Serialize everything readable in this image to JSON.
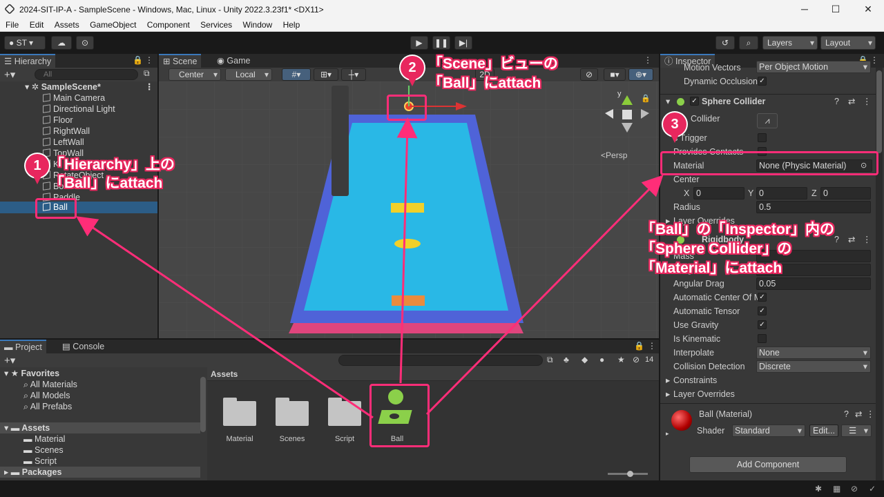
{
  "window": {
    "title": "2024-SIT-IP-A - SampleScene - Windows, Mac, Linux - Unity 2022.3.23f1* <DX11>",
    "minimize": "─",
    "maximize": "☐",
    "close": "✕"
  },
  "menu": [
    "File",
    "Edit",
    "Assets",
    "GameObject",
    "Component",
    "Services",
    "Window",
    "Help"
  ],
  "toolbar": {
    "account": "ST",
    "layers": "Layers",
    "layout": "Layout"
  },
  "hierarchy": {
    "tab": "Hierarchy",
    "search_placeholder": "All",
    "scene": "SampleScene*",
    "items": [
      "Main Camera",
      "Directional Light",
      "Floor",
      "RightWall",
      "LeftWall",
      "TopWall",
      "K",
      "RotateObject",
      "Bou",
      "Paddle",
      "Ball"
    ]
  },
  "scene_view": {
    "tab_scene": "Scene",
    "tab_game": "Game",
    "pivot": "Center",
    "space": "Local",
    "persp": "Persp",
    "mode2d": "2D",
    "gizmo_y": "y"
  },
  "inspector": {
    "tab": "Inspector",
    "top_rows": [
      {
        "label": "Motion Vectors",
        "value": "Per Object Motion"
      },
      {
        "label": "Dynamic Occlusion",
        "checked": "✓"
      }
    ],
    "sphere_collider": {
      "title": "Sphere Collider",
      "edit_collider": "Collider",
      "is_trigger": "s Trigger",
      "provides_contacts": "Provides Contacts",
      "material_label": "Material",
      "material_value": "None (Physic Material)",
      "center_label": "Center",
      "x": "0",
      "y": "0",
      "z": "0",
      "x_label": "X",
      "y_label": "Y",
      "z_label": "Z",
      "radius_label": "Radius",
      "radius_value": "0.5",
      "layer_overrides": "Layer Overrides"
    },
    "rigidbody": {
      "title": "Rigidbody",
      "mass": "Mass",
      "drag": "Drag",
      "angular_drag_label": "Angular Drag",
      "angular_drag": "0.05",
      "rows": [
        {
          "label": "Automatic Center Of M",
          "checked": "✓"
        },
        {
          "label": "Automatic Tensor",
          "checked": "✓"
        },
        {
          "label": "Use Gravity",
          "checked": "✓"
        },
        {
          "label": "Is Kinematic",
          "checked": ""
        }
      ],
      "interpolate_label": "Interpolate",
      "interpolate": "None",
      "collision_label": "Collision Detection",
      "collision": "Discrete",
      "constraints": "Constraints",
      "layer_overrides": "Layer Overrides"
    },
    "material": {
      "name": "Ball (Material)",
      "shader_label": "Shader",
      "shader": "Standard",
      "edit": "Edit..."
    },
    "add_component": "Add Component"
  },
  "project": {
    "tab_project": "Project",
    "tab_console": "Console",
    "hidden_count": "14",
    "favorites": "Favorites",
    "fav_items": [
      "All Materials",
      "All Models",
      "All Prefabs"
    ],
    "assets": "Assets",
    "asset_folders": [
      "Material",
      "Scenes",
      "Script"
    ],
    "packages": "Packages",
    "breadcrumb": "Assets",
    "grid": [
      "Material",
      "Scenes",
      "Script",
      "Ball"
    ]
  },
  "annotations": {
    "b1": "1",
    "b2": "2",
    "b3": "3",
    "a1_l1": "「Hierarchy」上の",
    "a1_l2": "「Ball」にattach",
    "a2_l1": "「Scene」ビューの",
    "a2_l2": "「Ball」にattach",
    "a3_l1": "「Ball」の「Inspector」内の",
    "a3_l2": "「Sphere Collider」の",
    "a3_l3": "「Material」にattach"
  },
  "colors": {
    "accent": "#ff2d78",
    "selection": "#2c5d87",
    "water": "#29b8e6",
    "wall": "#4f63d8"
  }
}
